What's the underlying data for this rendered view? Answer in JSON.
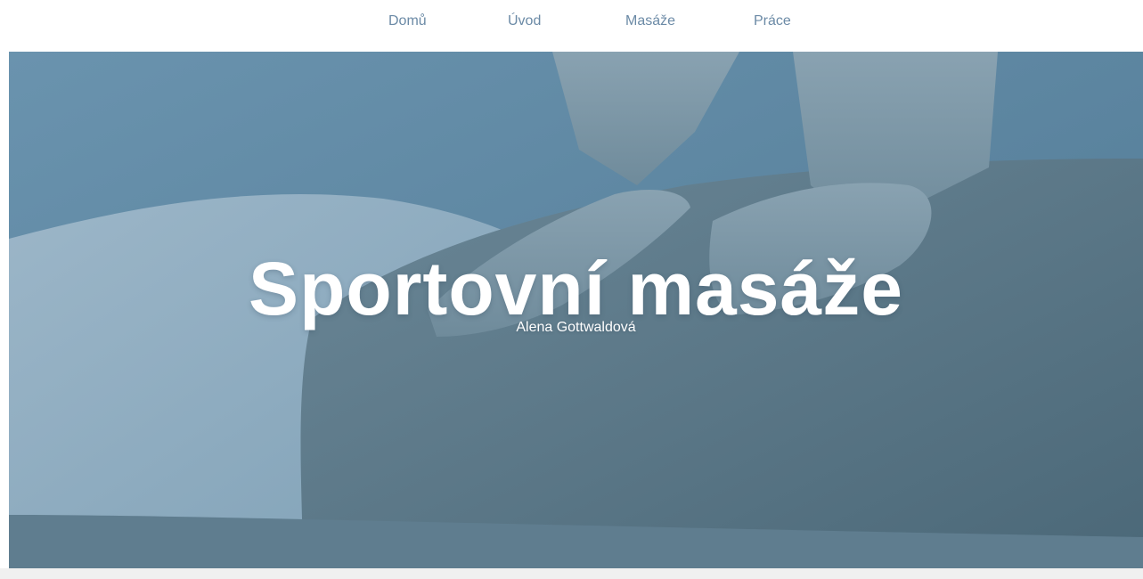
{
  "nav": {
    "items": [
      {
        "label": "Domů"
      },
      {
        "label": "Úvod"
      },
      {
        "label": "Masáže"
      },
      {
        "label": "Práce"
      }
    ]
  },
  "hero": {
    "title": "Sportovní masáže",
    "subtitle": "Alena Gottwaldová",
    "image_icon": "massage-photo"
  },
  "colors": {
    "nav_text": "#6b8aa6",
    "hero_overlay": "#5f88a4",
    "footer_strip": "#f0f0f0"
  }
}
